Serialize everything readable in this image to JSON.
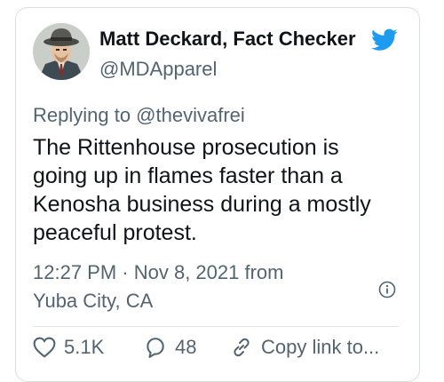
{
  "author": {
    "display_name": "Matt Deckard, Fact Checker",
    "handle": "@MDApparel",
    "avatar_icon": "avatar-fedora-illustration",
    "verified_icon": "twitter-bird-icon"
  },
  "reply_context": "Replying to @thevivafrei",
  "tweet_lines": [
    "The Rittenhouse prosecution is",
    "going up in flames faster than a",
    "Kenosha business during a mostly",
    "peaceful protest."
  ],
  "meta": {
    "time_date_source": "12:27 PM · Nov 8, 2021 from",
    "location": "Yuba City, CA"
  },
  "actions": {
    "likes": "5.1K",
    "replies": "48",
    "copy_link": "Copy link to..."
  },
  "colors": {
    "text": "#0f1419",
    "secondary": "#536471",
    "twitter_blue": "#1d9bf0",
    "border": "#d9dee2"
  }
}
